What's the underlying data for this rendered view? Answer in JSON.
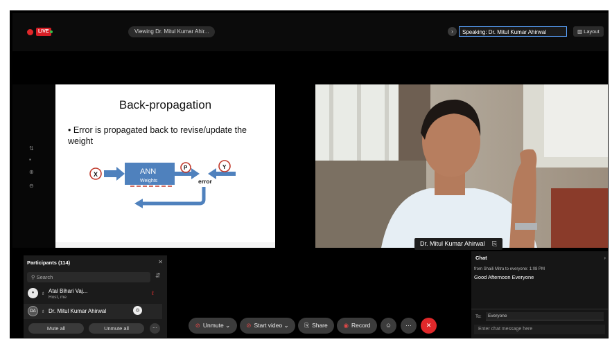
{
  "top": {
    "live_badge": "LIVE",
    "viewing": "Viewing Dr. Mitul Kumar Ahir...",
    "speaking": "Speaking: Dr. Mitul Kumar Ahirwal",
    "layout": "Layout"
  },
  "slide": {
    "title": "Back-propagation",
    "bullet": "• Error is propagated back to revise/update the weight",
    "box_label": "ANN",
    "box_sub": "Weights",
    "x": "X",
    "p": "P",
    "y": "Y",
    "error": "error"
  },
  "video": {
    "name": "Dr. Mitul Kumar Ahirwal"
  },
  "participants": {
    "title": "Participants (114)",
    "search_placeholder": "Search",
    "rows": [
      {
        "name": "Atal Bihari Vaj...",
        "sub": "Host, me",
        "avatar": ""
      },
      {
        "name": "Dr. Mitul Kumar Ahirwal",
        "sub": "",
        "avatar": "DA"
      }
    ],
    "mute_all": "Mute all",
    "unmute_all": "Unmute all"
  },
  "controls": {
    "unmute": "Unmute",
    "start_video": "Start video",
    "share": "Share",
    "record": "Record"
  },
  "chat": {
    "title": "Chat",
    "from": "from Shaili Mitra to everyone:   1:08 PM",
    "message": "Good Afternoon Everyone",
    "to_label": "To:",
    "to_value": "Everyone",
    "placeholder": "Enter chat message here"
  },
  "colors": {
    "accent": "#5aa3ff",
    "end_call": "#e0282a",
    "slide_box": "#4f81bd"
  }
}
